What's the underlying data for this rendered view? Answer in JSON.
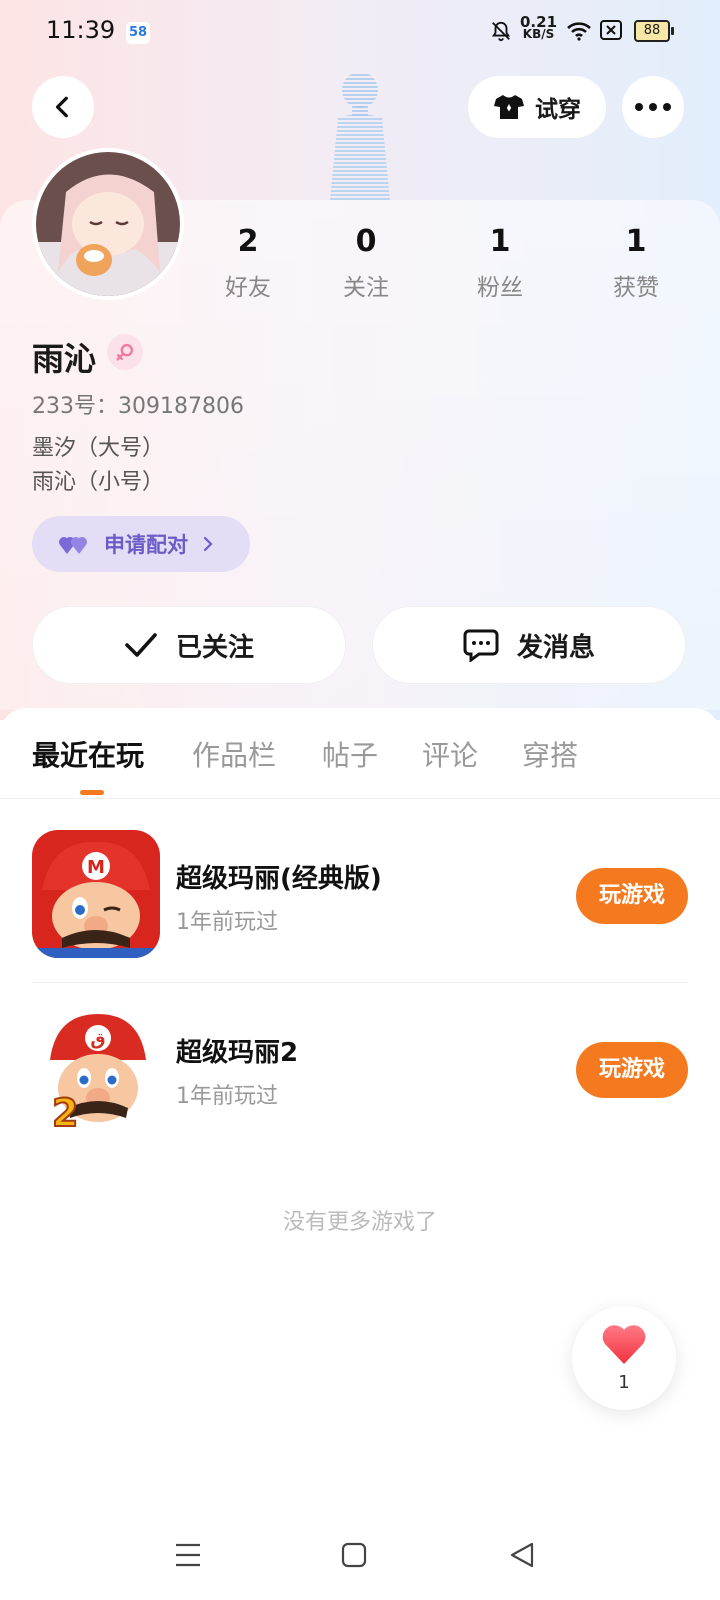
{
  "status_bar": {
    "time": "11:39",
    "app_badge": "58",
    "net_speed_value": "0.21",
    "net_speed_unit": "KB/S",
    "battery": "88"
  },
  "header": {
    "try_on_label": "试穿"
  },
  "profile": {
    "stats": [
      {
        "value": "2",
        "label": "好友"
      },
      {
        "value": "0",
        "label": "关注"
      },
      {
        "value": "1",
        "label": "粉丝"
      },
      {
        "value": "1",
        "label": "获赞"
      }
    ],
    "name": "雨沁",
    "uid_line": "233号：309187806",
    "aliases": [
      "墨汐（大号）",
      "雨沁（小号）"
    ],
    "pair_label": "申请配对",
    "followed_label": "已关注",
    "message_label": "发消息"
  },
  "tabs": [
    {
      "label": "最近在玩",
      "active": true
    },
    {
      "label": "作品栏",
      "active": false
    },
    {
      "label": "帖子",
      "active": false
    },
    {
      "label": "评论",
      "active": false
    },
    {
      "label": "穿搭",
      "active": false
    }
  ],
  "games": [
    {
      "title": "超级玛丽(经典版)",
      "last_played": "1年前玩过",
      "play_label": "玩游戏",
      "icon": "mario-classic-icon"
    },
    {
      "title": "超级玛丽2",
      "last_played": "1年前玩过",
      "play_label": "玩游戏",
      "icon": "mario-2-icon"
    }
  ],
  "no_more_text": "没有更多游戏了",
  "like_float": {
    "count": "1"
  },
  "colors": {
    "accent_orange": "#f57a1f",
    "pair_purple": "#6b5cc6",
    "pair_bg": "#e3def6"
  }
}
